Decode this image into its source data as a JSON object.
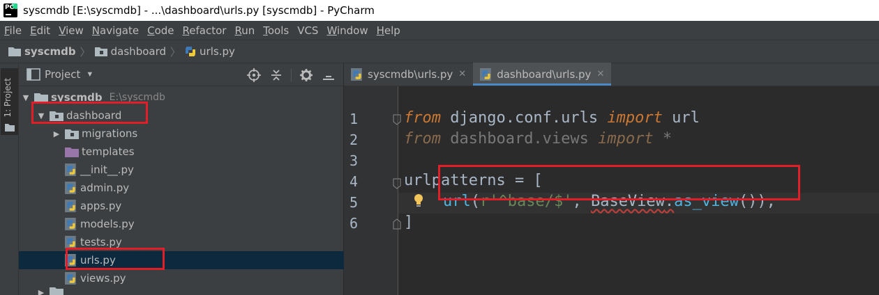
{
  "window": {
    "title": "syscmdb [E:\\syscmdb] - ...\\dashboard\\urls.py [syscmdb] - PyCharm"
  },
  "menu": [
    {
      "u": "F",
      "rest": "ile"
    },
    {
      "u": "E",
      "rest": "dit"
    },
    {
      "u": "V",
      "rest": "iew"
    },
    {
      "u": "N",
      "rest": "avigate"
    },
    {
      "u": "C",
      "rest": "ode"
    },
    {
      "u": "R",
      "rest": "efactor"
    },
    {
      "u": "R",
      "rest": "un"
    },
    {
      "u": "T",
      "rest": "ools"
    },
    {
      "u": "",
      "rest": "VCS"
    },
    {
      "u": "W",
      "rest": "indow"
    },
    {
      "u": "H",
      "rest": "elp"
    }
  ],
  "breadcrumb": {
    "root": "syscmdb",
    "folder": "dashboard",
    "file": "urls.py"
  },
  "stripe": {
    "label": "1: Project"
  },
  "project_panel": {
    "title": "Project",
    "root": {
      "name": "syscmdb",
      "path": "E:\\syscmdb"
    },
    "items": [
      {
        "label": "dashboard",
        "kind": "folder-expanded"
      },
      {
        "label": "migrations",
        "kind": "folder-collapsed"
      },
      {
        "label": "templates",
        "kind": "folder-templates"
      },
      {
        "label": "__init__.py",
        "kind": "python"
      },
      {
        "label": "admin.py",
        "kind": "python"
      },
      {
        "label": "apps.py",
        "kind": "python"
      },
      {
        "label": "models.py",
        "kind": "python"
      },
      {
        "label": "tests.py",
        "kind": "python"
      },
      {
        "label": "urls.py",
        "kind": "python-selected"
      },
      {
        "label": "views.py",
        "kind": "python"
      }
    ]
  },
  "editor": {
    "tabs": [
      {
        "label": "syscmdb\\urls.py",
        "active": false
      },
      {
        "label": "dashboard\\urls.py",
        "active": true
      }
    ],
    "line_numbers": [
      "1",
      "2",
      "3",
      "4",
      "5",
      "6"
    ],
    "code": {
      "l1": {
        "kw1": "from",
        "mod": " django.conf.urls ",
        "kw2": "import",
        "name": " url"
      },
      "l2": {
        "kw1": "from",
        "mod": " dashboard.views ",
        "kw2": "import",
        "name": " *"
      },
      "l4": {
        "name": "urlpatterns",
        "rest": " = ["
      },
      "l5": {
        "fn": "url",
        "p1": "(",
        "str": "r'^base/$'",
        "comma": ", ",
        "cls": "BaseView",
        "dot": ".",
        "meth": "as_view",
        "tail": "()),"
      },
      "l6": {
        "text": "]"
      }
    }
  },
  "colors": {
    "annotation": "#e21e28",
    "keyword": "#cc7832",
    "string": "#6a8759",
    "selection": "#0d293e",
    "tab_underline": "#4a88c7"
  }
}
